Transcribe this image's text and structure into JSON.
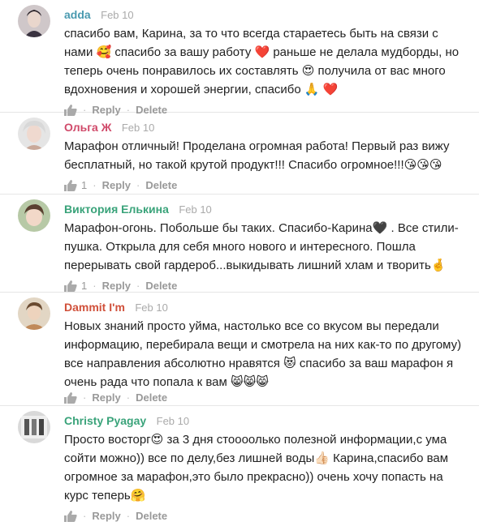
{
  "actions": {
    "reply": "Reply",
    "delete": "Delete",
    "separator": "·"
  },
  "comments": [
    {
      "author": "adda",
      "author_color": "#4a9ab0",
      "date": "Feb 10",
      "likes": "",
      "text": "спасибо вам, Карина, за то что всегда стараетесь быть на связи с нами 🥰 спасибо за вашу работу ❤️ раньше не делала мудборды, но теперь очень понравилось их составлять 😍 получила от вас много вдохновения и хорошей энергии, спасибо 🙏 ❤️"
    },
    {
      "author": "Ольга Ж",
      "author_color": "#d04a6a",
      "date": "Feb 10",
      "likes": "1",
      "text": "Марафон отличный! Проделана огромная работа! Первый раз вижу бесплатный, но такой крутой продукт!!! Спасибо огромное!!!😘😘😘"
    },
    {
      "author": "Виктория Елькина",
      "author_color": "#3aa37a",
      "date": "Feb 10",
      "likes": "1",
      "text": "Марафон-огонь. Побольше бы таких. Спасибо-Карина🖤 . Все стили-пушка. Открыла для себя много нового и интересного. Пошла перерывать свой гардероб...выкидывать лишний хлам и творить🤞"
    },
    {
      "author": "Dammit I'm",
      "author_color": "#d0503a",
      "date": "Feb 10",
      "likes": "",
      "text": "Новых знаний просто уйма, настолько все со вкусом вы передали информацию, перебирала вещи и смотрела на них как-то по другому) все направления абсолютно нравятся 😻 спасибо за ваш марафон я очень рада что попала к вам 😸😸😸"
    },
    {
      "author": "Christy Pyagay",
      "author_color": "#3aa37a",
      "date": "Feb 10",
      "likes": "",
      "text": "Просто восторг😍 за 3 дня стоооолько полезной информации,с ума сойти можно)) все по делу,без лишней воды👍🏻 Карина,спасибо вам огромное за марафон,это было прекрасно)) очень хочу попасть на курс теперь🤗"
    }
  ]
}
